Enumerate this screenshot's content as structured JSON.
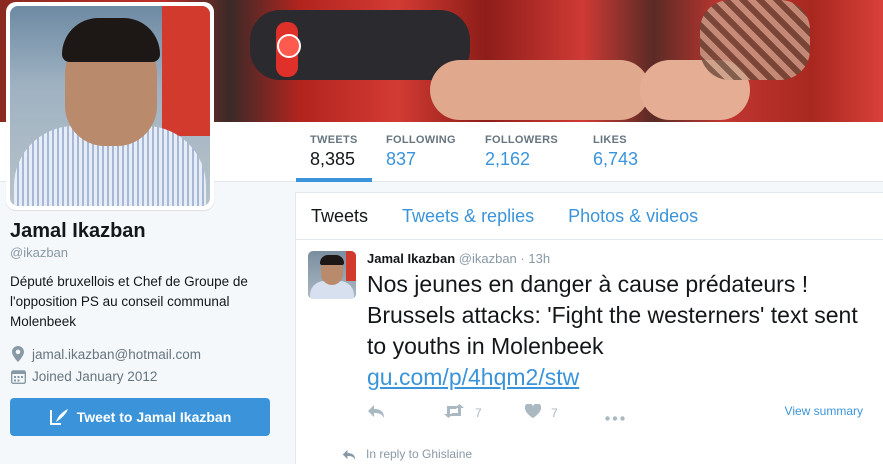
{
  "profile": {
    "name": "Jamal Ikazban",
    "handle": "@ikazban",
    "bio": "Député bruxellois et Chef de Groupe de l'opposition PS au conseil communal Molenbeek",
    "email": "jamal.ikazban@hotmail.com",
    "joined": "Joined January 2012",
    "tweet_to_label": "Tweet to Jamal Ikazban"
  },
  "stats": [
    {
      "label": "TWEETS",
      "value": "8,385"
    },
    {
      "label": "FOLLOWING",
      "value": "837"
    },
    {
      "label": "FOLLOWERS",
      "value": "2,162"
    },
    {
      "label": "LIKES",
      "value": "6,743"
    }
  ],
  "tabs": [
    "Tweets",
    "Tweets & replies",
    "Photos & videos"
  ],
  "tweet": {
    "name": "Jamal Ikazban",
    "handle": "@ikazban",
    "dot": "·",
    "time": "13h",
    "text": "Nos jeunes en danger à cause prédateurs ! Brussels attacks: 'Fight the westerners' text sent to youths in Molenbeek",
    "link": "gu.com/p/4hqm2/stw",
    "retweets": "7",
    "likes": "7",
    "view_summary": "View summary"
  },
  "reply": {
    "text": "In reply to Ghislaine"
  },
  "colors": {
    "accent": "#3b94d9",
    "text": "#14171a",
    "muted": "#8899a6"
  },
  "icons": [
    "location-icon",
    "calendar-icon",
    "quill-icon",
    "reply-icon",
    "retweet-icon",
    "heart-icon",
    "more-icon"
  ]
}
